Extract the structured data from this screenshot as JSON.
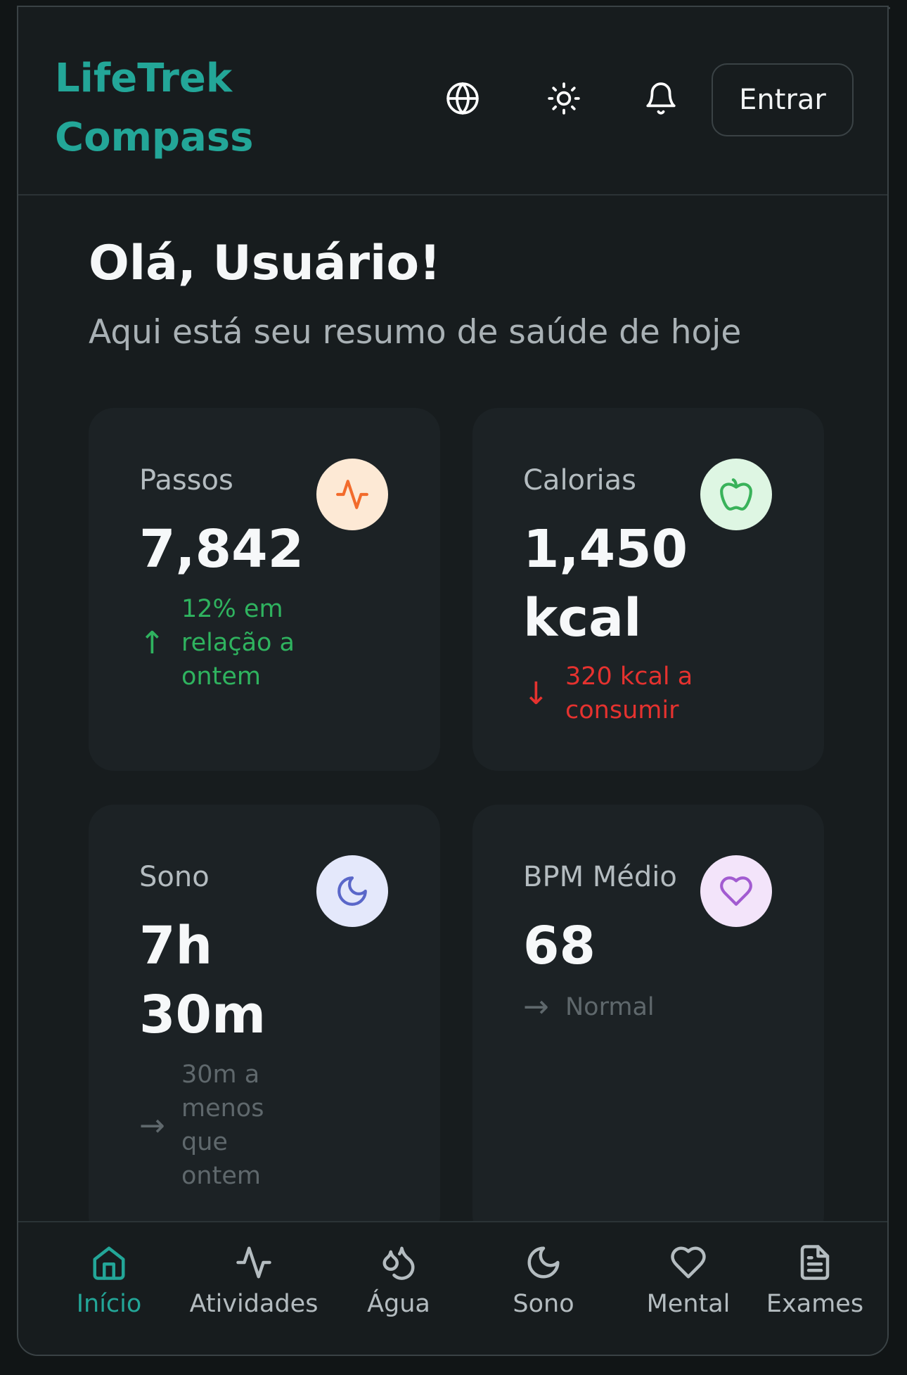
{
  "app": {
    "brand_line1": "LifeTrek",
    "brand_line2": "Compass",
    "login_label": "Entrar"
  },
  "header_icons": [
    "globe-icon",
    "sun-icon",
    "bell-icon"
  ],
  "greeting": {
    "title": "Olá, Usuário!",
    "subtitle": "Aqui está seu resumo de saúde de hoje"
  },
  "cards": {
    "steps": {
      "label": "Passos",
      "value": "7,842",
      "trend_text": "12% em relação a ontem",
      "trend": "up",
      "icon": "activity-icon",
      "color": "#2fb35f"
    },
    "calories": {
      "label": "Calorias",
      "value": "1,450 kcal",
      "trend_text": "320 kcal a consumir",
      "trend": "down",
      "icon": "apple-icon",
      "color": "#e5322f"
    },
    "sleep": {
      "label": "Sono",
      "value": "7h 30m",
      "trend_text": "30m a menos que ontem",
      "trend": "neutral",
      "icon": "moon-icon",
      "color": "#5f686c"
    },
    "bpm": {
      "label": "BPM Médio",
      "value": "68",
      "trend_text": "Normal",
      "trend": "neutral",
      "icon": "heart-icon",
      "color": "#5f686c"
    }
  },
  "nav": [
    {
      "label": "Início",
      "icon": "home-icon",
      "active": true
    },
    {
      "label": "Atividades",
      "icon": "activity-icon",
      "active": false
    },
    {
      "label": "Água",
      "icon": "droplets-icon",
      "active": false
    },
    {
      "label": "Sono",
      "icon": "moon-icon",
      "active": false
    },
    {
      "label": "Mental",
      "icon": "heart-icon",
      "active": false
    },
    {
      "label": "Exames",
      "icon": "document-icon",
      "active": false
    }
  ],
  "colors": {
    "accent": "#23a698",
    "background": "#171c1e",
    "card": "#1c2225"
  }
}
